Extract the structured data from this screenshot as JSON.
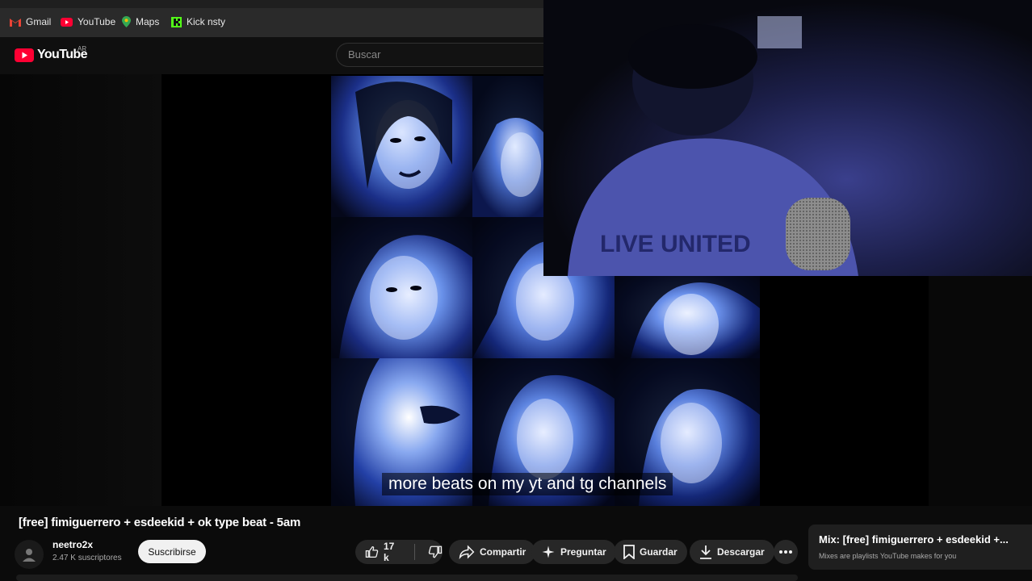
{
  "bookmarks": [
    {
      "label": "Gmail",
      "icon": "gmail-icon"
    },
    {
      "label": "YouTube",
      "icon": "youtube-icon"
    },
    {
      "label": "Maps",
      "icon": "maps-icon"
    },
    {
      "label": "Kick nsty",
      "icon": "kick-icon"
    }
  ],
  "header": {
    "logo_text": "YouTube",
    "region": "AR",
    "search_placeholder": "Buscar"
  },
  "video": {
    "caption": "more beats on my yt and tg channels",
    "webcam_shirt_text": "LIVE UNITED"
  },
  "info": {
    "title": "[free] fimiguerrero + esdeekid + ok type beat - 5am",
    "channel": "neetro2x",
    "subscribers": "2.47 K suscriptores",
    "subscribe_label": "Suscribirse"
  },
  "actions": {
    "likes": "17 k",
    "share": "Compartir",
    "ask": "Preguntar",
    "save": "Guardar",
    "download": "Descargar"
  },
  "mix": {
    "title": "Mix: [free] fimiguerrero + esdeekid +...",
    "subtitle": "Mixes are playlists YouTube makes for you"
  },
  "colors": {
    "accent_red": "#ff0033",
    "bg": "#0f0f0f",
    "pill": "#272727",
    "tint_blue": "#2a4fbf"
  }
}
